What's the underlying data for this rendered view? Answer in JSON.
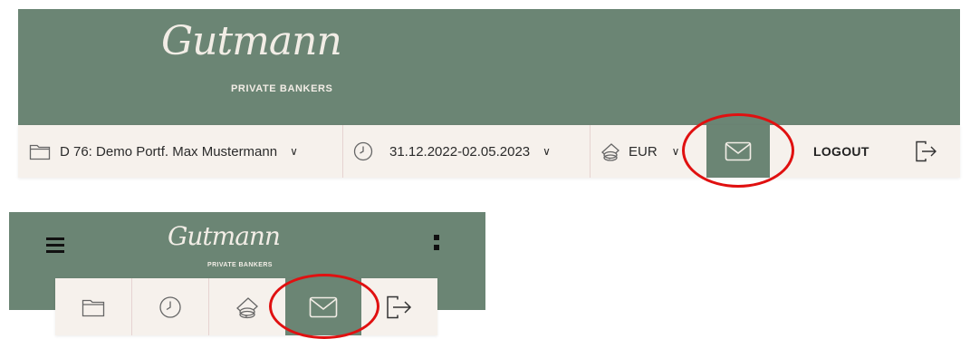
{
  "desktop": {
    "brand": {
      "script": "Gutmann",
      "subtitle": "PRIVATE BANKERS"
    },
    "portfolio": {
      "icon": "folder-icon",
      "label": "D 76: Demo Portf. Max Mustermann"
    },
    "date_range": {
      "icon": "clock-icon",
      "label": "31.12.2022-02.05.2023"
    },
    "currency": {
      "icon": "coins-icon",
      "label": "EUR"
    },
    "mail": {
      "icon": "mail-icon"
    },
    "logout": {
      "label": "LOGOUT",
      "icon": "logout-icon"
    }
  },
  "mobile": {
    "brand": {
      "script": "Gutmann",
      "subtitle": "PRIVATE BANKERS"
    },
    "menu_icon": "hamburger-icon",
    "more_icon": "kebab-icon",
    "toolbar_icons": [
      "folder-icon",
      "clock-icon",
      "coins-icon",
      "mail-icon",
      "logout-icon"
    ]
  },
  "colors": {
    "brand_green": "#6b8574",
    "toolbar_bg": "#f6f1ec",
    "annotation_red": "#e01010"
  }
}
